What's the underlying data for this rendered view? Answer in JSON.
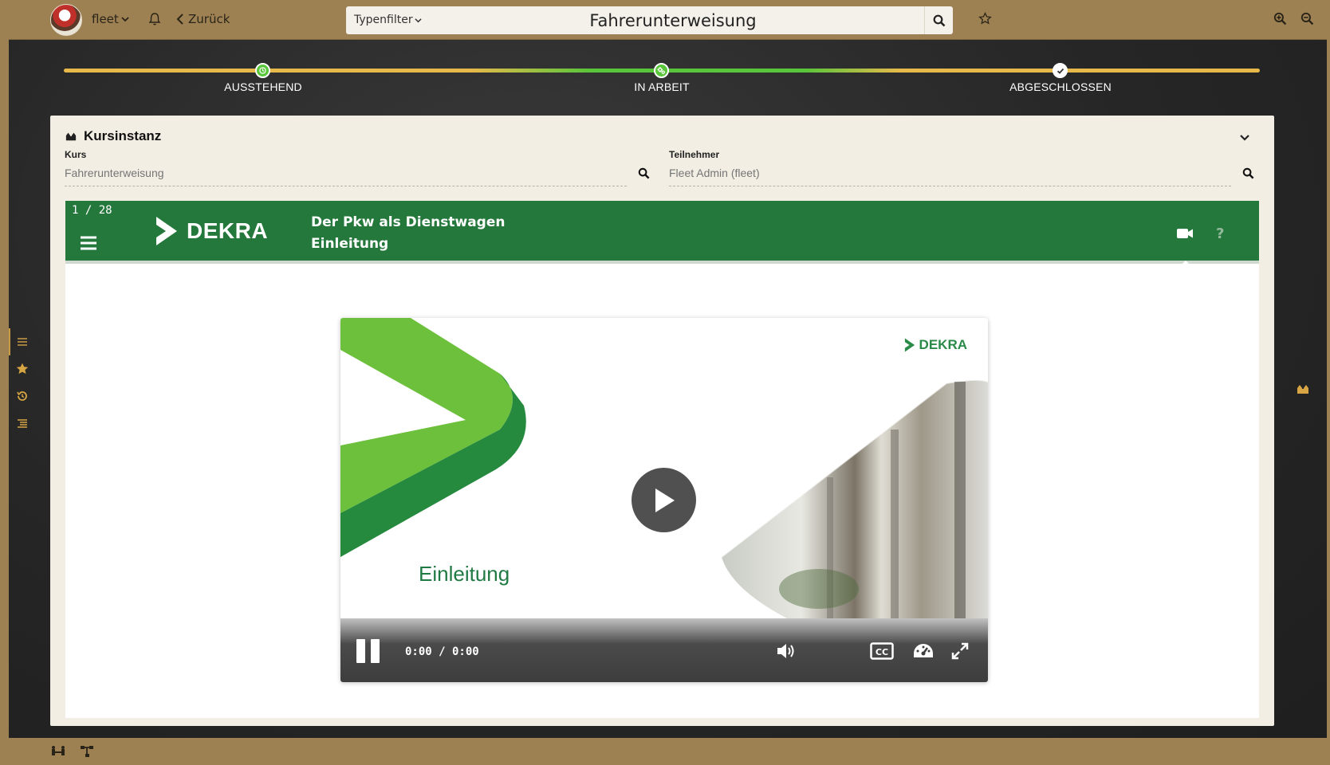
{
  "topbar": {
    "user_label": "fleet",
    "back_label": "Zurück",
    "type_filter_label": "Typenfilter",
    "search_value": "Fahrerunterweisung"
  },
  "progress": {
    "steps": [
      {
        "label": "AUSSTEHEND",
        "state": "done"
      },
      {
        "label": "IN ARBEIT",
        "state": "active"
      },
      {
        "label": "ABGESCHLOSSEN",
        "state": "pending"
      }
    ]
  },
  "panel": {
    "title": "Kursinstanz",
    "course_label": "Kurs",
    "course_placeholder": "Fahrerunterweisung",
    "participant_label": "Teilnehmer",
    "participant_placeholder": "Fleet Admin (fleet)"
  },
  "player": {
    "slide_counter": "1 / 28",
    "brand": "DEKRA",
    "title_line1": "Der Pkw als Dienstwagen",
    "title_line2": "Einleitung",
    "help_label": "?",
    "video_brand": "DEKRA",
    "video_caption": "Einleitung",
    "time": "0:00 / 0:00"
  },
  "icons": {
    "topbar": [
      "avatar",
      "chevron-down-icon",
      "bell-icon",
      "chevron-left-icon",
      "search-icon",
      "star-outline-icon",
      "zoom-in-icon",
      "zoom-out-icon"
    ],
    "leftnav": [
      "list-icon",
      "star-icon",
      "history-icon",
      "outline-list-icon"
    ],
    "player": [
      "hamburger-icon",
      "video-camera-icon",
      "play-icon",
      "pause-icon",
      "volume-icon",
      "closed-captions-icon",
      "speed-icon",
      "fullscreen-icon"
    ]
  },
  "colors": {
    "frame_brown": "#9d8152",
    "dekra_green": "#25783c",
    "progress_yellow": "#e7b94b",
    "progress_green": "#59c53a",
    "panel_bg": "#f2eee4"
  }
}
